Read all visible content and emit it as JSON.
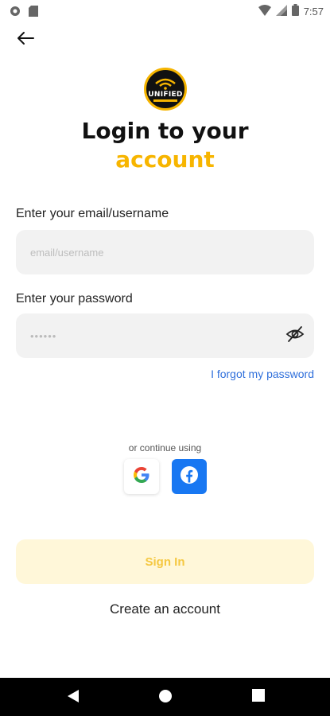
{
  "status_bar": {
    "time": "7:57",
    "icons": [
      "settings-circle-icon",
      "sd-card-icon",
      "wifi-icon",
      "signal-icon",
      "battery-icon"
    ]
  },
  "header": {
    "back_icon": "arrow-left-icon"
  },
  "logo": {
    "text": "UNIFIED"
  },
  "title": {
    "line1": "Login to your",
    "line2": "account"
  },
  "form": {
    "email_label": "Enter your email/username",
    "email_placeholder": "email/username",
    "email_value": "",
    "password_label": "Enter your password",
    "password_value": "••••••",
    "password_toggle_icon": "eye-off-icon",
    "forgot_link": "I forgot my password"
  },
  "social": {
    "or_text": "or continue using",
    "providers": [
      "google",
      "facebook"
    ]
  },
  "actions": {
    "signin_label": "Sign In",
    "create_account_label": "Create an account"
  },
  "colors": {
    "accent": "#f7b500",
    "link": "#2f6fdb",
    "signin_bg": "#fff7d9",
    "input_bg": "#f2f2f2",
    "facebook": "#1877f2"
  },
  "nav_bar": {
    "buttons": [
      "back-triangle-icon",
      "home-circle-icon",
      "recents-square-icon"
    ]
  }
}
